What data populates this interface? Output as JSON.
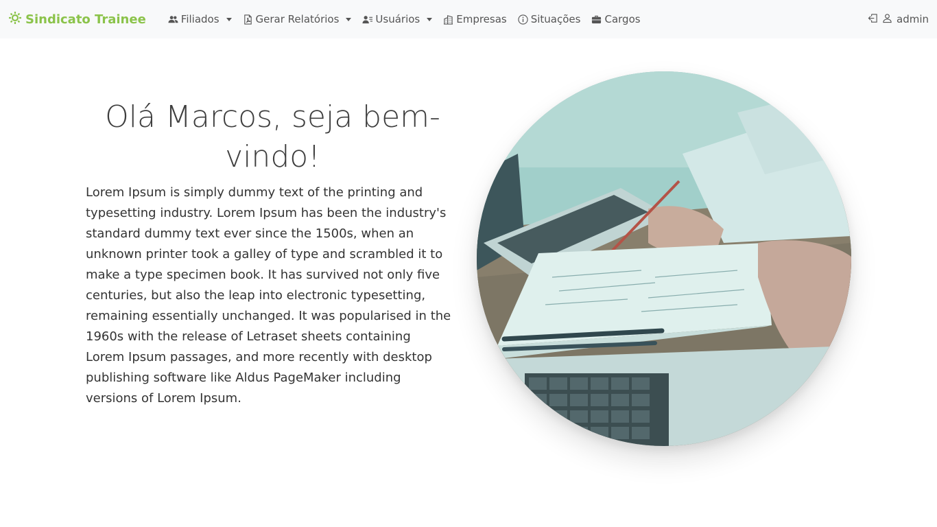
{
  "brand": {
    "name": "Sindicato Trainee",
    "icon": "gear-icon",
    "color": "#8bc34a"
  },
  "nav": {
    "items": [
      {
        "label": "Filiados",
        "icon": "users-icon",
        "dropdown": true
      },
      {
        "label": "Gerar Relatórios",
        "icon": "file-pdf-icon",
        "dropdown": true
      },
      {
        "label": "Usuários",
        "icon": "user-list-icon",
        "dropdown": true
      },
      {
        "label": "Empresas",
        "icon": "building-icon",
        "dropdown": false
      },
      {
        "label": "Situações",
        "icon": "info-circle-icon",
        "dropdown": false
      },
      {
        "label": "Cargos",
        "icon": "briefcase-icon",
        "dropdown": false
      }
    ],
    "user": {
      "label": "admin",
      "logout_icon": "logout-icon",
      "user_icon": "person-icon"
    }
  },
  "hero": {
    "greeting": "Olá Marcos, seja bem-vindo!",
    "text": "Lorem Ipsum is simply dummy text of the printing and typesetting industry. Lorem Ipsum has been the industry's standard dummy text ever since the 1500s, when an unknown printer took a galley of type and scrambled it to make a type specimen book. It has survived not only five centuries, but also the leap into electronic typesetting, remaining essentially unchanged. It was popularised in the 1960s with the release of Letraset sheets containing Lorem Ipsum passages, and more recently with desktop publishing software like Aldus PageMaker including versions of Lorem Ipsum."
  },
  "colors": {
    "navbar_bg": "#f8f9fa",
    "text": "#444444"
  }
}
